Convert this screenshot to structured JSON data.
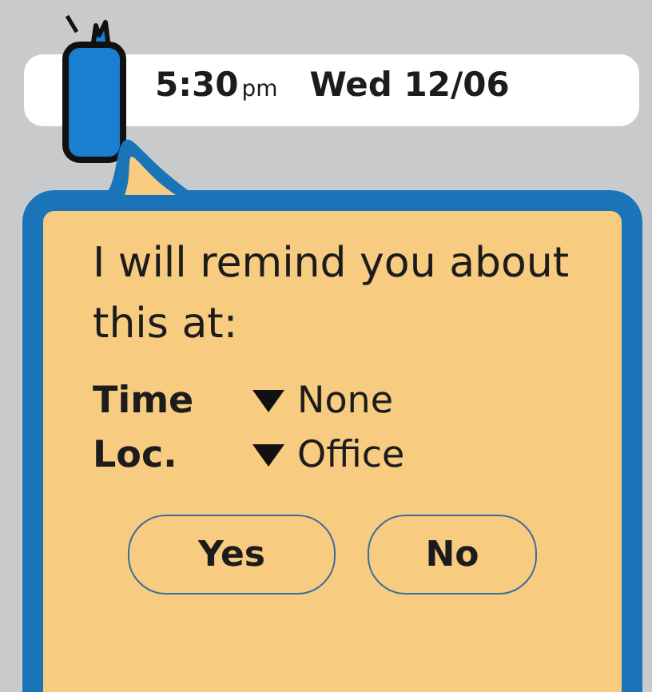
{
  "status_bar": {
    "time": "5:30",
    "time_suffix": "pm",
    "date": "Wed 12/06"
  },
  "dialog": {
    "message": "I will remind you about this at:",
    "fields": [
      {
        "label": "Time",
        "value": "None"
      },
      {
        "label": "Loc.",
        "value": "Office"
      }
    ],
    "buttons": [
      {
        "label": "Yes"
      },
      {
        "label": "No"
      }
    ]
  }
}
